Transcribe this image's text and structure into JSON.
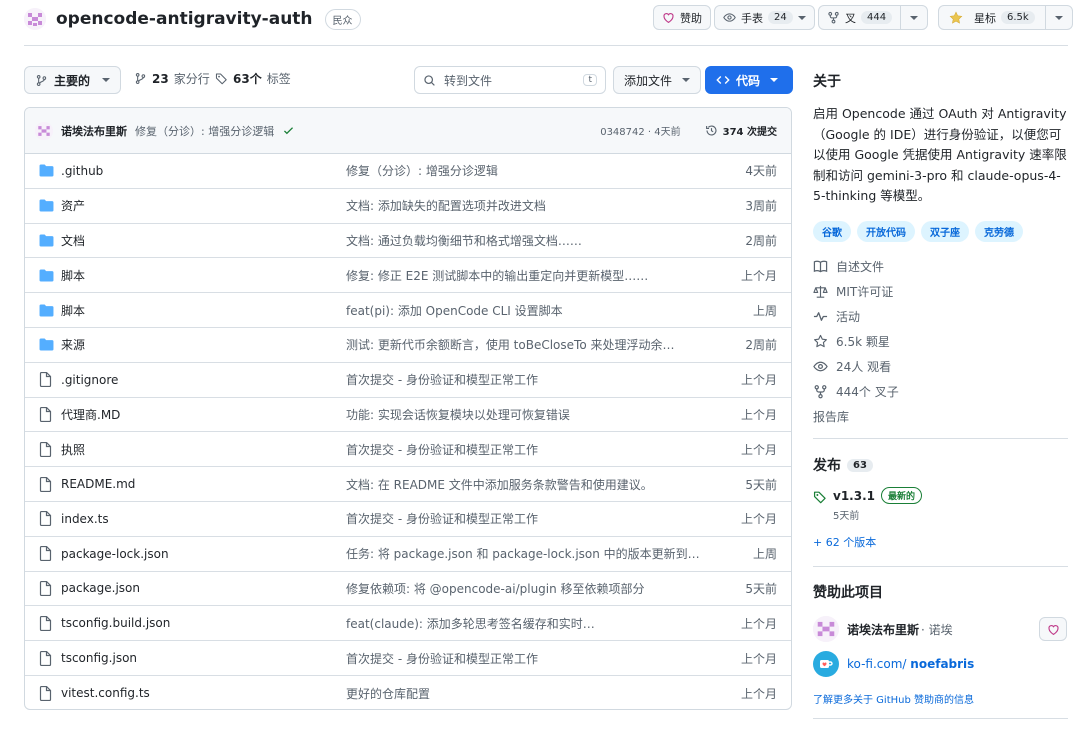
{
  "repo": {
    "name": "opencode-antigravity-auth",
    "visibility": "民众"
  },
  "header": {
    "sponsor_label": "赞助",
    "watch_label": "手表",
    "watch_count": "24",
    "fork_label": "叉",
    "fork_count": "444",
    "star_label": "星标",
    "star_count": "6.5k"
  },
  "toolbar": {
    "branch": "主要的",
    "branches": "23",
    "branches_label": "家分行",
    "tags": "63个",
    "tags_label": "标签",
    "search_placeholder": "转到文件",
    "search_key": "t",
    "add_file": "添加文件",
    "code": "代码"
  },
  "latest_commit": {
    "author": "诺埃法布里斯",
    "message": "修复（分诊）: 增强分诊逻辑",
    "hash_time": "0348742 · 4天前",
    "commits_count": "374 次提交"
  },
  "files": [
    {
      "type": "dir",
      "name": ".github",
      "message": "修复（分诊）: 增强分诊逻辑",
      "age": "4天前"
    },
    {
      "type": "dir",
      "name": "资产",
      "message": "文档: 添加缺失的配置选项并改进文档",
      "age": "3周前"
    },
    {
      "type": "dir",
      "name": "文档",
      "message": "文档: 通过负载均衡细节和格式增强文档……",
      "age": "2周前"
    },
    {
      "type": "dir",
      "name": "脚本",
      "message": "修复: 修正 E2E 测试脚本中的输出重定向并更新模型……",
      "age": "上个月"
    },
    {
      "type": "dir",
      "name": "脚本",
      "message": "feat(pi): 添加 OpenCode CLI 设置脚本",
      "age": "上周"
    },
    {
      "type": "dir",
      "name": "来源",
      "message": "测试: 更新代币余额断言，使用 toBeCloseTo 来处理浮动余…",
      "age": "2周前"
    },
    {
      "type": "file",
      "name": ".gitignore",
      "message": "首次提交 - 身份验证和模型正常工作",
      "age": "上个月"
    },
    {
      "type": "file",
      "name": "代理商.MD",
      "message": "功能: 实现会话恢复模块以处理可恢复错误",
      "age": "上个月"
    },
    {
      "type": "file",
      "name": "执照",
      "message": "首次提交 - 身份验证和模型正常工作",
      "age": "上个月"
    },
    {
      "type": "file",
      "name": "README.md",
      "message": "文档: 在 README 文件中添加服务条款警告和使用建议。",
      "age": "5天前"
    },
    {
      "type": "file",
      "name": "index.ts",
      "message": "首次提交 - 身份验证和模型正常工作",
      "age": "上个月"
    },
    {
      "type": "file",
      "name": "package-lock.json",
      "message": "任务: 将 package.json 和 package-lock.json 中的版本更新到…",
      "age": "上周"
    },
    {
      "type": "file",
      "name": "package.json",
      "message": "修复依赖项: 将 @opencode-ai/plugin 移至依赖项部分",
      "age": "5天前"
    },
    {
      "type": "file",
      "name": "tsconfig.build.json",
      "message": "feat(claude): 添加多轮思考签名缓存和实时…",
      "age": "上个月"
    },
    {
      "type": "file",
      "name": "tsconfig.json",
      "message": "首次提交 - 身份验证和模型正常工作",
      "age": "上个月"
    },
    {
      "type": "file",
      "name": "vitest.config.ts",
      "message": "更好的仓库配置",
      "age": "上个月"
    }
  ],
  "about": {
    "title": "关于",
    "description": "启用 Opencode 通过 OAuth 对 Antigravity（Google 的 IDE）进行身份验证，以便您可以使用 Google 凭据使用 Antigravity 速率限制和访问 gemini-3-pro 和 claude-opus-4-5-thinking 等模型。",
    "topics": [
      "谷歌",
      "开放代码",
      "双子座",
      "克劳德"
    ],
    "links": [
      {
        "icon": "book-icon",
        "label": "自述文件"
      },
      {
        "icon": "scale-icon",
        "label": "MIT许可证"
      },
      {
        "icon": "pulse-icon",
        "label": "活动"
      },
      {
        "icon": "star-icon",
        "label": "6.5k 颗星"
      },
      {
        "icon": "eye-icon",
        "label": "24人 观看"
      },
      {
        "icon": "fork-icon",
        "label": "444个 叉子"
      }
    ],
    "report": "报告库"
  },
  "releases": {
    "title": "发布",
    "count": "63",
    "latest_version": "v1.3.1",
    "latest_badge": "最新的",
    "latest_age": "5天前",
    "more": "+ 62 个版本"
  },
  "sponsor": {
    "title": "赞助此项目",
    "name": "诺埃法布里斯",
    "handle": "· 诺埃",
    "kofi_prefix": "ko-fi.com/",
    "kofi_user": "noefabris",
    "learn_more": "了解更多关于 GitHub 赞助商的信息"
  },
  "colors": {
    "accent": "#1f6feb",
    "folder": "#54aeff",
    "link": "#0969da",
    "green": "#1a7f37"
  }
}
